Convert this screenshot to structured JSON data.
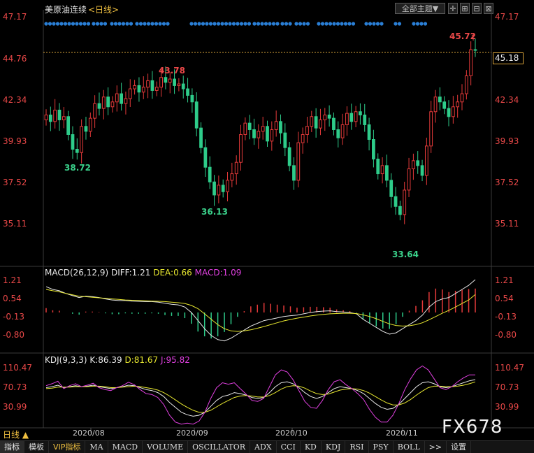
{
  "header": {
    "title": "美原油连续",
    "period_link": "<日线>",
    "theme_select": "全部主题▼"
  },
  "price_axis": {
    "ticks": [
      "47.17",
      "44.76",
      "42.34",
      "39.93",
      "37.52",
      "35.11"
    ],
    "current_price": "45.18"
  },
  "annotations": {
    "high_right": "45.72",
    "high_left": "43.78",
    "low_1": "38.72",
    "low_2": "36.13",
    "low_3": "33.64"
  },
  "macd": {
    "title": "MACD(26,12,9)",
    "diff": "DIFF:1.21",
    "dea": "DEA:0.66",
    "macd": "MACD:1.09",
    "ticks": [
      "1.21",
      "0.54",
      "-0.13",
      "-0.80"
    ]
  },
  "kdj": {
    "title": "KDJ(9,3,3)",
    "k": "K:86.39",
    "d": "D:81.67",
    "j": "J:95.82",
    "ticks": [
      "110.47",
      "70.73",
      "30.99"
    ]
  },
  "date_axis": [
    "2020/08",
    "2020/09",
    "2020/10",
    "2020/11"
  ],
  "period_button": "日线 ▲",
  "watermark": "FX678",
  "tabs": [
    "指标",
    "模板",
    "VIP指标",
    "MA",
    "MACD",
    "VOLUME",
    "OSCILLATOR",
    "ADX",
    "CCI",
    "KD",
    "KDJ",
    "RSI",
    "PSY",
    "BOLL",
    ">>",
    "设置"
  ],
  "colors": {
    "up": "#e63a3a",
    "down": "#2ecc8a",
    "accent": "#f0c040",
    "dots": "#2a7fd6",
    "kdj_j": "#e040e0"
  },
  "chart_data": {
    "type": "candlestick",
    "title": "美原油连续",
    "x": [
      "2020/08",
      "2020/09",
      "2020/10",
      "2020/11"
    ],
    "price": {
      "ylim": [
        33.64,
        47.17
      ],
      "notable": {
        "high": 45.72,
        "prior_high": 43.78,
        "lows": [
          38.72,
          36.13,
          33.64
        ],
        "last": 45.18
      },
      "closes": [
        41.2,
        40.8,
        41.5,
        40.9,
        41.1,
        40.0,
        39.1,
        38.9,
        40.5,
        40.2,
        41.0,
        41.9,
        41.6,
        42.3,
        41.7,
        42.0,
        42.5,
        41.9,
        42.2,
        42.8,
        43.0,
        42.6,
        42.9,
        43.3,
        42.7,
        42.9,
        43.5,
        43.2,
        43.4,
        43.0,
        43.1,
        42.8,
        42.4,
        42.0,
        40.4,
        39.2,
        38.0,
        37.1,
        36.3,
        36.9,
        36.5,
        37.2,
        37.6,
        38.3,
        40.0,
        40.7,
        40.3,
        39.8,
        40.2,
        40.5,
        39.6,
        40.3,
        40.8,
        40.1,
        39.2,
        38.1,
        37.2,
        39.5,
        40.0,
        40.5,
        41.1,
        40.4,
        40.9,
        41.2,
        41.0,
        40.3,
        39.8,
        40.6,
        41.3,
        40.8,
        41.4,
        41.2,
        40.6,
        39.7,
        38.5,
        37.6,
        38.1,
        37.2,
        36.2,
        35.6,
        35.1,
        36.6,
        37.9,
        38.4,
        38.1,
        37.5,
        39.3,
        41.4,
        42.3,
        42.0,
        41.6,
        41.1,
        41.7,
        42.0,
        42.5,
        43.6,
        45.2,
        45.18
      ]
    },
    "macd": {
      "ylim": [
        -1.2,
        1.4
      ],
      "diff_last": 1.21,
      "dea_last": 0.66,
      "hist_last": 1.09,
      "diff": [
        0.95,
        0.85,
        0.8,
        0.7,
        0.62,
        0.55,
        0.6,
        0.58,
        0.55,
        0.5,
        0.46,
        0.44,
        0.44,
        0.42,
        0.41,
        0.4,
        0.4,
        0.38,
        0.34,
        0.3,
        0.28,
        0.2,
        0.0,
        -0.3,
        -0.6,
        -0.85,
        -1.0,
        -1.05,
        -0.95,
        -0.8,
        -0.65,
        -0.5,
        -0.4,
        -0.3,
        -0.25,
        -0.2,
        -0.15,
        -0.12,
        -0.1,
        -0.05,
        0.0,
        0.03,
        0.05,
        0.06,
        0.03,
        0.02,
        0.0,
        -0.05,
        -0.25,
        -0.4,
        -0.55,
        -0.7,
        -0.8,
        -0.75,
        -0.6,
        -0.45,
        -0.3,
        -0.1,
        0.2,
        0.4,
        0.5,
        0.55,
        0.7,
        0.85,
        1.0,
        1.21
      ],
      "dea": [
        0.85,
        0.8,
        0.76,
        0.7,
        0.65,
        0.6,
        0.58,
        0.56,
        0.54,
        0.52,
        0.5,
        0.48,
        0.46,
        0.45,
        0.44,
        0.43,
        0.42,
        0.41,
        0.4,
        0.38,
        0.36,
        0.33,
        0.26,
        0.14,
        -0.05,
        -0.25,
        -0.45,
        -0.6,
        -0.68,
        -0.7,
        -0.68,
        -0.64,
        -0.58,
        -0.52,
        -0.45,
        -0.38,
        -0.31,
        -0.26,
        -0.21,
        -0.17,
        -0.13,
        -0.1,
        -0.07,
        -0.05,
        -0.04,
        -0.03,
        -0.03,
        -0.04,
        -0.09,
        -0.15,
        -0.23,
        -0.33,
        -0.42,
        -0.48,
        -0.5,
        -0.49,
        -0.45,
        -0.38,
        -0.27,
        -0.15,
        -0.03,
        0.08,
        0.2,
        0.33,
        0.46,
        0.66
      ]
    },
    "kdj": {
      "ylim": [
        0,
        120
      ],
      "k_last": 86.39,
      "d_last": 81.67,
      "j_last": 95.82,
      "k": [
        70,
        72,
        75,
        70,
        72,
        74,
        72,
        73,
        75,
        72,
        70,
        68,
        70,
        72,
        75,
        74,
        70,
        66,
        64,
        60,
        52,
        40,
        30,
        20,
        15,
        12,
        14,
        20,
        32,
        44,
        52,
        55,
        60,
        58,
        55,
        50,
        48,
        50,
        60,
        72,
        80,
        82,
        78,
        70,
        60,
        52,
        48,
        52,
        60,
        68,
        72,
        70,
        68,
        64,
        58,
        48,
        38,
        30,
        26,
        28,
        36,
        48,
        60,
        72,
        80,
        82,
        78,
        72,
        70,
        72,
        76,
        80,
        84,
        86.39
      ],
      "d": [
        68,
        69,
        71,
        71,
        71,
        72,
        72,
        72,
        73,
        73,
        72,
        70,
        70,
        71,
        72,
        73,
        72,
        70,
        68,
        65,
        60,
        53,
        45,
        37,
        30,
        24,
        20,
        20,
        24,
        31,
        38,
        44,
        50,
        53,
        54,
        53,
        51,
        51,
        54,
        60,
        67,
        72,
        74,
        73,
        69,
        63,
        58,
        56,
        57,
        61,
        65,
        67,
        68,
        67,
        64,
        59,
        52,
        45,
        39,
        35,
        35,
        39,
        46,
        55,
        63,
        70,
        73,
        73,
        72,
        72,
        73,
        75,
        78,
        81.67
      ],
      "j": [
        74,
        78,
        83,
        68,
        74,
        78,
        72,
        75,
        79,
        70,
        66,
        64,
        70,
        74,
        81,
        76,
        66,
        58,
        56,
        50,
        36,
        14,
        0,
        -4,
        -2,
        -4,
        2,
        20,
        48,
        70,
        80,
        77,
        80,
        68,
        57,
        44,
        42,
        48,
        72,
        96,
        106,
        102,
        86,
        64,
        42,
        30,
        28,
        44,
        66,
        82,
        86,
        76,
        68,
        58,
        46,
        26,
        10,
        0,
        0,
        14,
        38,
        66,
        88,
        106,
        114,
        106,
        88,
        70,
        66,
        72,
        82,
        90,
        96,
        95.82
      ]
    }
  }
}
